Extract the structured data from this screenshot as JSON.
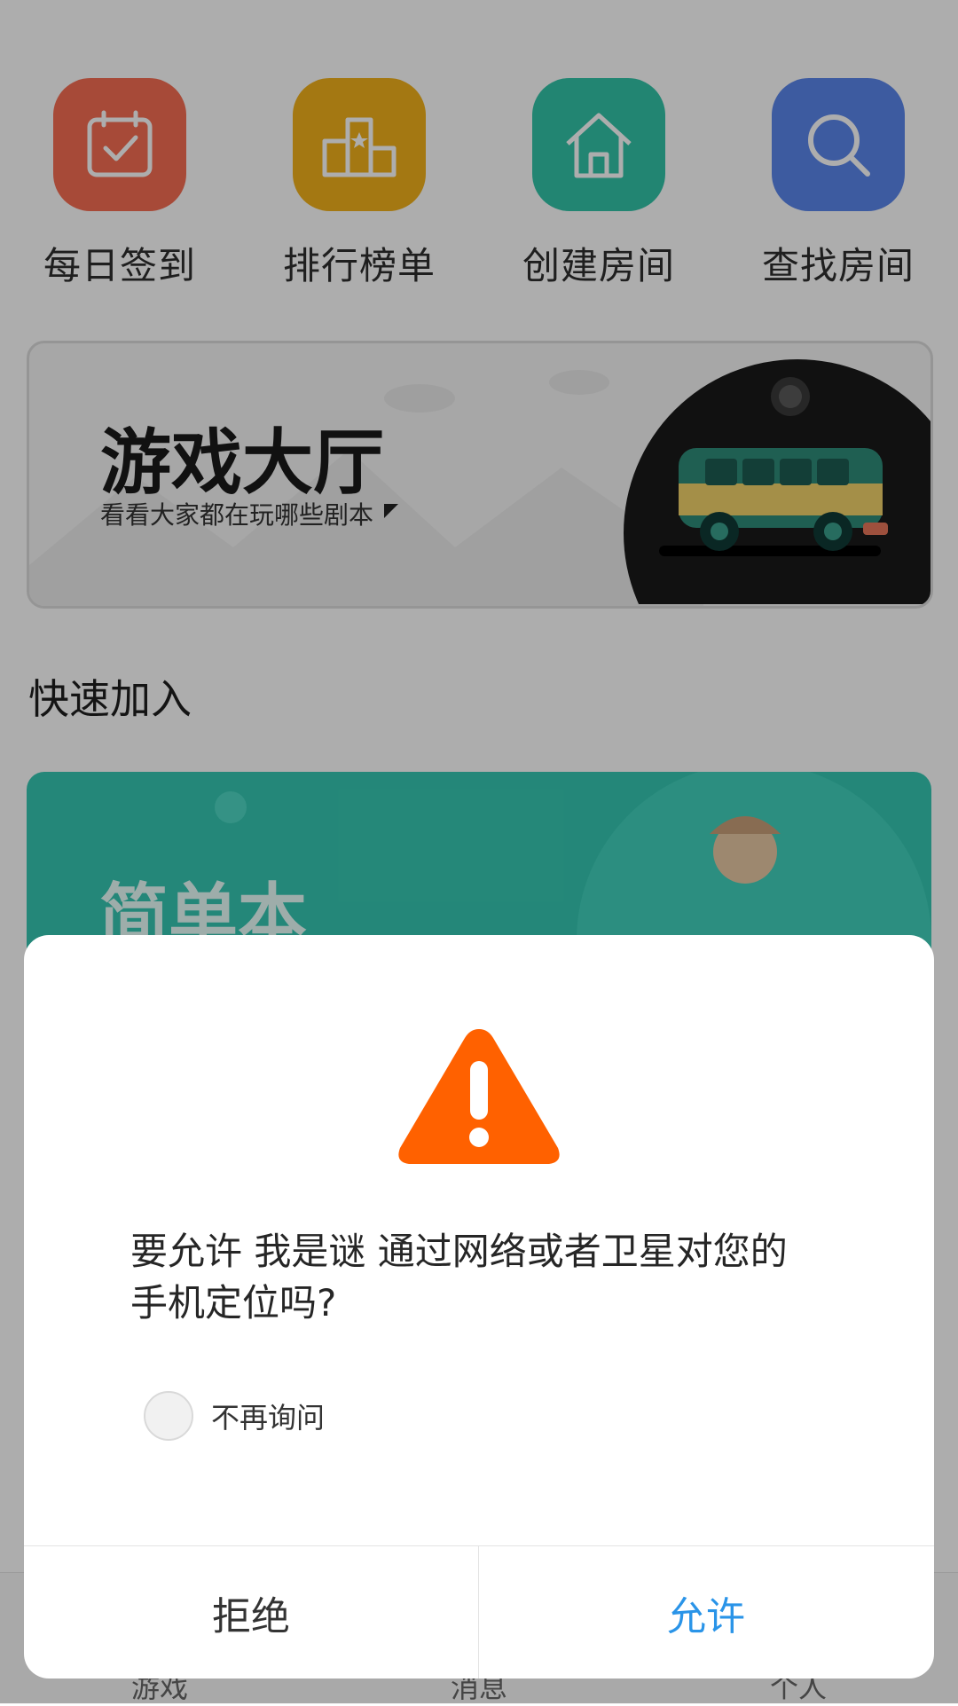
{
  "actions": [
    {
      "label": "每日签到",
      "icon": "calendar-check-icon",
      "color": "#f76d53"
    },
    {
      "label": "排行榜单",
      "icon": "podium-icon",
      "color": "#f2b11b"
    },
    {
      "label": "创建房间",
      "icon": "home-icon",
      "color": "#33c5a8"
    },
    {
      "label": "查找房间",
      "icon": "search-icon",
      "color": "#5b86ec"
    }
  ],
  "hall": {
    "title": "游戏大厅",
    "subtitle": "看看大家都在玩哪些剧本"
  },
  "quick_join": {
    "title": "快速加入"
  },
  "simple_card": {
    "title": "简单本"
  },
  "bottom_nav": [
    {
      "label": "游戏"
    },
    {
      "label": "消息"
    },
    {
      "label": "个人"
    }
  ],
  "dialog": {
    "icon": "warning-icon",
    "accent_color": "#ff6100",
    "message": "要允许 我是谜 通过网络或者卫星对您的手机定位吗?",
    "dont_ask_label": "不再询问",
    "deny_label": "拒绝",
    "allow_label": "允许",
    "allow_color": "#2a94e8"
  }
}
